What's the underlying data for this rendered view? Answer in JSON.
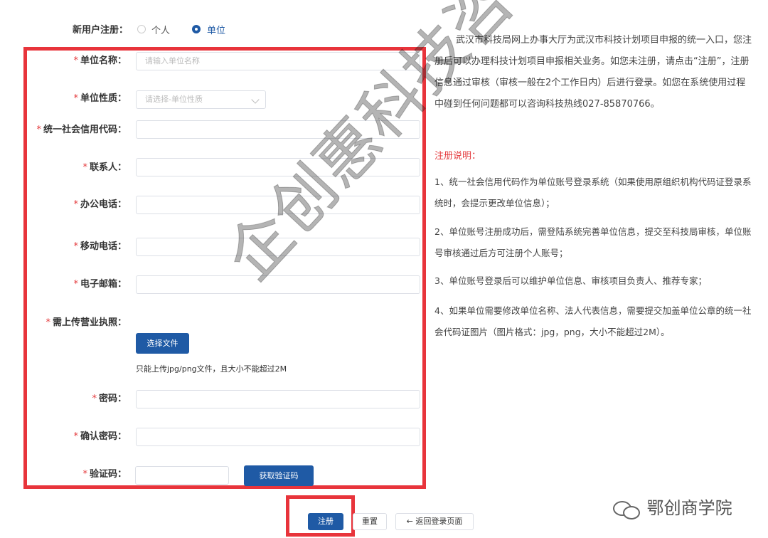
{
  "form": {
    "user_type": {
      "label": "新用户注册：",
      "option_personal": "个人",
      "option_unit": "单位",
      "selected": "单位"
    },
    "unit_name": {
      "label": "单位名称：",
      "placeholder": "请输入单位名称"
    },
    "unit_nature": {
      "label": "单位性质：",
      "placeholder": "请选择-单位性质"
    },
    "credit_code": {
      "label": "统一社会信用代码："
    },
    "contact": {
      "label": "联系人："
    },
    "office_phone": {
      "label": "办公电话："
    },
    "mobile_phone": {
      "label": "移动电话："
    },
    "email": {
      "label": "电子邮箱："
    },
    "license": {
      "label": "需上传营业执照：",
      "button": "选择文件",
      "hint": "只能上传jpg/png文件，且大小不能超过2M"
    },
    "password": {
      "label": "密码："
    },
    "confirm_password": {
      "label": "确认密码："
    },
    "captcha": {
      "label": "验证码：",
      "button": "获取验证码"
    },
    "required_mark": "*"
  },
  "actions": {
    "register": "注册",
    "reset": "重置",
    "back": "← 返回登录页面"
  },
  "info": {
    "intro": "武汉市科技局网上办事大厅为武汉市科技计划项目申报的统一入口，您注册后可以办理科技计划项目申报相关业务。如您未注册，请点击“注册”，注册信息通过审核（审核一般在2个工作日内）后进行登录。如您在系统使用过程中碰到任何问题都可以咨询科技热线027-85870766。",
    "notes_title": "注册说明：",
    "notes": [
      "1、统一社会信用代码作为单位账号登录系统（如果使用原组织机构代码证登录系统时，会提示更改单位信息）；",
      "2、单位账号注册成功后，需登陆系统完善单位信息，提交至科技局审核，单位账号审核通过后方可注册个人账号；",
      "3、单位账号登录后可以维护单位信息、审核项目负责人、推荐专家；",
      "4、如果单位需要修改单位名称、法人代表信息，需要提交加盖单位公章的统一社会代码证图片（图片格式：jpg，png，大小不能超过2M）。"
    ]
  },
  "overlay": {
    "watermark": "企创惠科技咨询",
    "wechat_brand": "鄂创商学院"
  },
  "colors": {
    "primary": "#1f5aa5",
    "required": "#e4393c",
    "highlight_box": "#e8343b",
    "notes_title": "#e4393c"
  }
}
